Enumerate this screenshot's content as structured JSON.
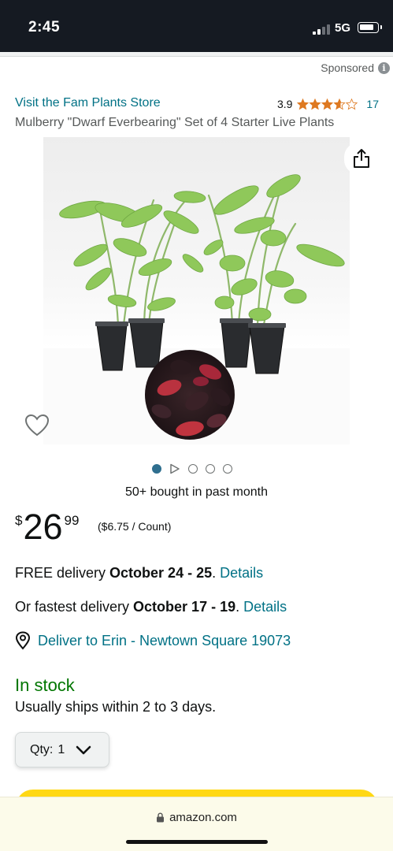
{
  "status_bar": {
    "time": "2:45",
    "network": "5G",
    "icons": [
      "signal-icon",
      "battery-icon"
    ]
  },
  "ad": {
    "sponsored_label": "Sponsored",
    "info_icon": "i"
  },
  "product": {
    "store_link": "Visit the Fam Plants Store",
    "rating_value": "3.9",
    "rating_stars": 3.9,
    "rating_count": "17",
    "title": "Mulberry \"Dwarf Everbearing\" Set of 4 Starter Live Plants"
  },
  "gallery": {
    "image_count": 5,
    "active_index": 0,
    "has_video": true
  },
  "social_proof": "50+ bought in past month",
  "price": {
    "symbol": "$",
    "whole": "26",
    "fraction": "99",
    "unit_price": "($6.75 / Count)"
  },
  "delivery": {
    "free_prefix": "FREE delivery ",
    "free_dates": "October 24 - 25",
    "free_suffix": ". ",
    "free_link": "Details",
    "fast_prefix": "Or fastest delivery ",
    "fast_dates": "October 17 - 19",
    "fast_suffix": ". ",
    "fast_link": "Details",
    "deliver_to": "Deliver to Erin - Newtown Square 19073"
  },
  "stock": {
    "status": "In stock",
    "shipping_note": "Usually ships within 2 to 3 days."
  },
  "quantity": {
    "label": "Qty:",
    "value": "1"
  },
  "browser": {
    "url": "amazon.com"
  },
  "colors": {
    "link": "#007185",
    "in_stock": "#007600",
    "star": "#de7921",
    "buy_button": "#ffd814",
    "status_bar": "#151a22"
  }
}
